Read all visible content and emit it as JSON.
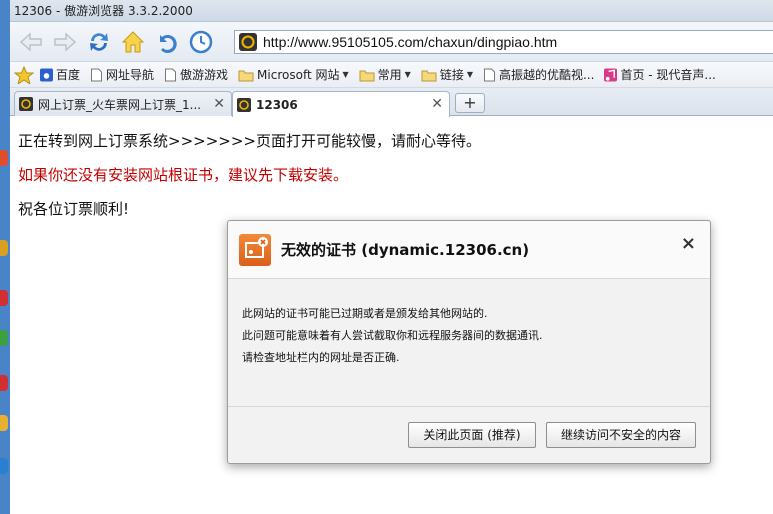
{
  "window": {
    "title": "12306 - 傲游浏览器 3.3.2.2000"
  },
  "navbar": {
    "url": "http://www.95105105.com/chaxun/dingpiao.htm"
  },
  "bookmarks": [
    {
      "label": "百度",
      "icon": "baidu-icon",
      "dropdown": false
    },
    {
      "label": "网址导航",
      "icon": "page-icon",
      "dropdown": false
    },
    {
      "label": "傲游游戏",
      "icon": "page-icon",
      "dropdown": false
    },
    {
      "label": "Microsoft 网站",
      "icon": "folder-icon",
      "dropdown": true
    },
    {
      "label": "常用",
      "icon": "folder-icon",
      "dropdown": true
    },
    {
      "label": "链接",
      "icon": "folder-icon",
      "dropdown": true
    },
    {
      "label": "高振越的优酷视...",
      "icon": "page-icon",
      "dropdown": false
    },
    {
      "label": "首页 - 现代音声...",
      "icon": "music-icon",
      "dropdown": false
    }
  ],
  "tabs": [
    {
      "label": "网上订票_火车票网上订票_1...",
      "active": false
    },
    {
      "label": "12306",
      "active": true
    }
  ],
  "newtab_label": "+",
  "content": {
    "line1": "正在转到网上订票系统>>>>>>>页面打开可能较慢，请耐心等待。",
    "line2": "如果你还没有安装网站根证书，建议先下载安装。",
    "line3": "祝各位订票顺利!"
  },
  "dialog": {
    "title": "无效的证书 (dynamic.12306.cn)",
    "close": "×",
    "lines": [
      "此网站的证书可能已过期或者是颁发给其他网站的.",
      "此问题可能意味着有人尝试截取你和远程服务器间的数据通讯.",
      "请检查地址栏内的网址是否正确."
    ],
    "close_page_button": "关闭此页面 (推荐)",
    "continue_button": "继续访问不安全的内容"
  },
  "colors": {
    "warning_text": "#c40000",
    "dialog_icon": "#e0701f"
  }
}
